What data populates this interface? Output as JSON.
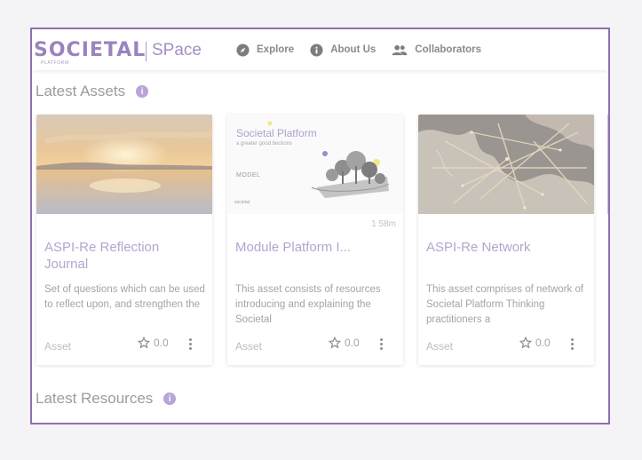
{
  "header": {
    "logo_text": "SOCIETAL",
    "logo_subtext": "PLATFORM",
    "logo_space": "SPace",
    "nav": [
      {
        "label": "Explore",
        "icon": "compass-icon"
      },
      {
        "label": "About Us",
        "icon": "info-icon"
      },
      {
        "label": "Collaborators",
        "icon": "people-icon"
      }
    ]
  },
  "sections": {
    "latest_assets": "Latest Assets",
    "latest_resources": "Latest Resources",
    "info_glyph": "i"
  },
  "cards": [
    {
      "title": "ASPI-Re Reflection Journal",
      "description": "Set of questions which can be used to reflect upon, and strengthen the",
      "type": "Asset",
      "rating": "0.0",
      "thumb": "sunset-reflection-image"
    },
    {
      "title": "Module Platform I...",
      "description": "This asset consists of resources introducing and explaining the Societal",
      "type": "Asset",
      "rating": "0.0",
      "duration": "1 58m",
      "thumb_title": "Societal Platform",
      "thumb_subtitle": "a greater good beckons",
      "thumb_label": "MODEL",
      "thumb_brand": "societal"
    },
    {
      "title": "ASPI-Re Network",
      "description": "This asset comprises of network of Societal Platform Thinking practitioners a",
      "type": "Asset",
      "rating": "0.0",
      "thumb": "europe-network-map-image"
    }
  ],
  "colors": {
    "frame": "#8f6fb0",
    "accent": "#b9a3d7"
  }
}
